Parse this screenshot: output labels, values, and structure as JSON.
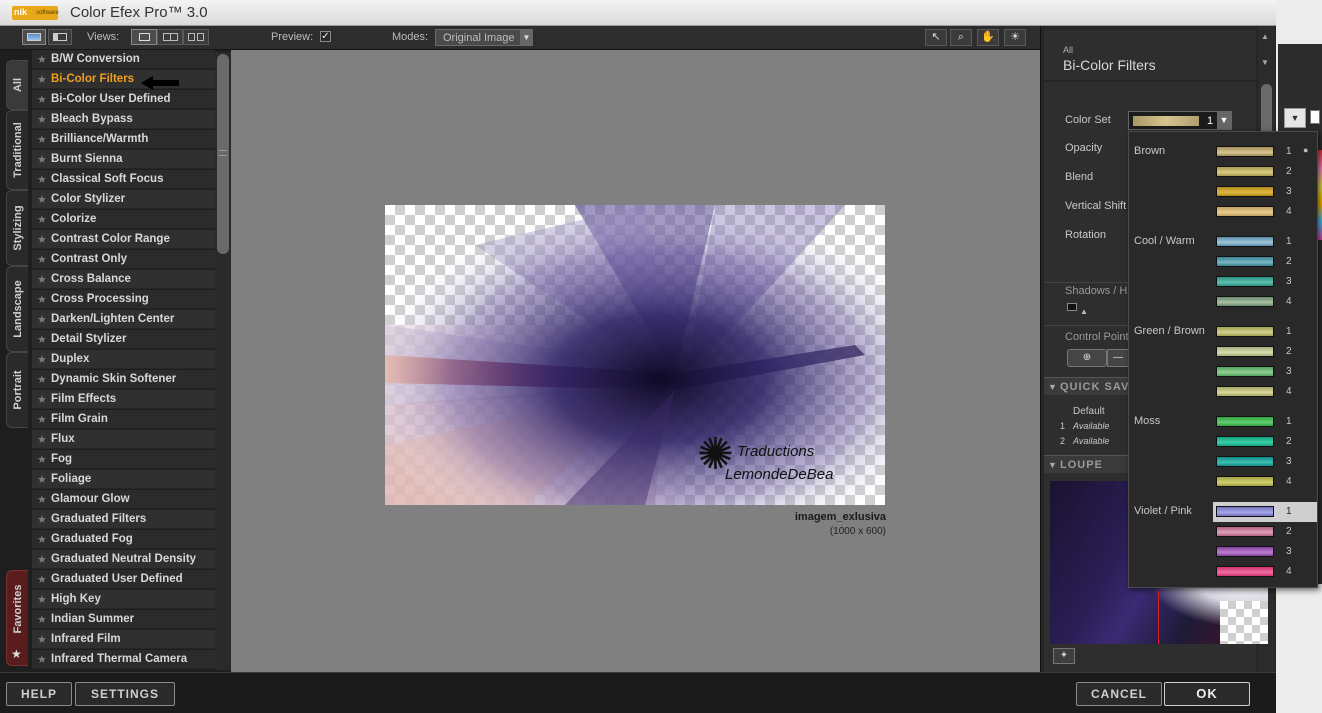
{
  "window": {
    "title": "Color Efex Pro™ 3.0",
    "logo_text": "nik",
    "logo_sub": "software"
  },
  "toolbar": {
    "views_label": "Views:",
    "preview_label": "Preview:",
    "preview_checked": true,
    "modes_label": "Modes:",
    "modes_value": "Original Image"
  },
  "tabs": [
    {
      "label": "All",
      "active": true
    },
    {
      "label": "Traditional"
    },
    {
      "label": "Stylizing"
    },
    {
      "label": "Landscape"
    },
    {
      "label": "Portrait"
    }
  ],
  "favorites_tab": "Favorites",
  "filters": [
    "B/W Conversion",
    "Bi-Color Filters",
    "Bi-Color User Defined",
    "Bleach Bypass",
    "Brilliance/Warmth",
    "Burnt Sienna",
    "Classical Soft Focus",
    "Color Stylizer",
    "Colorize",
    "Contrast Color Range",
    "Contrast Only",
    "Cross Balance",
    "Cross Processing",
    "Darken/Lighten Center",
    "Detail Stylizer",
    "Duplex",
    "Dynamic Skin Softener",
    "Film Effects",
    "Film Grain",
    "Flux",
    "Fog",
    "Foliage",
    "Glamour Glow",
    "Graduated Filters",
    "Graduated Fog",
    "Graduated Neutral Density",
    "Graduated User Defined",
    "High Key",
    "Indian Summer",
    "Infrared Film",
    "Infrared Thermal Camera"
  ],
  "selected_filter_index": 1,
  "image": {
    "name": "imagem_exlusiva",
    "size": "(1000 x 600)",
    "watermark_line1": "Traductions",
    "watermark_line2": "LemondeDeBea"
  },
  "right_panel": {
    "category": "All",
    "title": "Bi-Color Filters",
    "color_set_label": "Color Set",
    "color_set_value": "1",
    "params": [
      "Opacity",
      "Blend",
      "Vertical Shift",
      "Rotation"
    ],
    "shadows_label": "Shadows / H",
    "control_points_label": "Control Points",
    "quick_save_label": "QUICK SAV",
    "quick_save_header": "Default",
    "quick_save_slots": [
      {
        "n": "1",
        "label": "Available"
      },
      {
        "n": "2",
        "label": "Available"
      }
    ],
    "loupe_label": "LOUPE"
  },
  "color_set_dropdown": [
    {
      "group": "Brown",
      "options": [
        {
          "n": "1",
          "colors": [
            "#a08a5a",
            "#d8c890"
          ],
          "current": true
        },
        {
          "n": "2",
          "colors": [
            "#a89a50",
            "#d8cc80"
          ]
        },
        {
          "n": "3",
          "colors": [
            "#b08a20",
            "#e0b840"
          ]
        },
        {
          "n": "4",
          "colors": [
            "#c0a060",
            "#e8cc90"
          ]
        }
      ]
    },
    {
      "group": "Cool / Warm",
      "options": [
        {
          "n": "1",
          "colors": [
            "#5a8aa8",
            "#a0c8d8"
          ]
        },
        {
          "n": "2",
          "colors": [
            "#3a8090",
            "#78b8c0"
          ]
        },
        {
          "n": "3",
          "colors": [
            "#2a9080",
            "#60c0b0"
          ]
        },
        {
          "n": "4",
          "colors": [
            "#6a8a70",
            "#a8c0a0"
          ]
        }
      ]
    },
    {
      "group": "Green / Brown",
      "options": [
        {
          "n": "1",
          "colors": [
            "#a0a050",
            "#d0d090"
          ]
        },
        {
          "n": "2",
          "colors": [
            "#a8b080",
            "#d8dcb0"
          ]
        },
        {
          "n": "3",
          "colors": [
            "#50a060",
            "#90d090"
          ]
        },
        {
          "n": "4",
          "colors": [
            "#a8a860",
            "#d8d8a0"
          ]
        }
      ]
    },
    {
      "group": "Moss",
      "options": [
        {
          "n": "1",
          "colors": [
            "#30a040",
            "#60d070"
          ]
        },
        {
          "n": "2",
          "colors": [
            "#10a080",
            "#40d0a8"
          ]
        },
        {
          "n": "3",
          "colors": [
            "#108888",
            "#40c0b0"
          ]
        },
        {
          "n": "4",
          "colors": [
            "#a0a040",
            "#d0d070"
          ]
        }
      ]
    },
    {
      "group": "Violet / Pink",
      "options": [
        {
          "n": "1",
          "colors": [
            "#7070c0",
            "#a8a8e8"
          ],
          "highlight": true
        },
        {
          "n": "2",
          "colors": [
            "#b06080",
            "#e0a0b8"
          ]
        },
        {
          "n": "3",
          "colors": [
            "#8040a0",
            "#c080d0"
          ]
        },
        {
          "n": "4",
          "colors": [
            "#d03070",
            "#f070a0"
          ]
        }
      ]
    }
  ],
  "bottom": {
    "help": "HELP",
    "settings": "SETTINGS",
    "cancel": "CANCEL",
    "ok": "OK"
  }
}
